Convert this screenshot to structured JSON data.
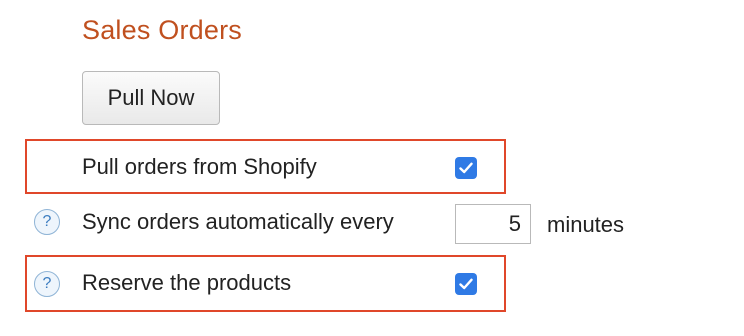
{
  "section": {
    "title": "Sales Orders"
  },
  "pull_button": {
    "label": "Pull Now"
  },
  "settings": {
    "pull_orders": {
      "label": "Pull orders from Shopify",
      "checked": true
    },
    "sync_interval": {
      "help_icon": "?",
      "label": "Sync orders automatically every",
      "value": "5",
      "unit": "minutes"
    },
    "reserve_products": {
      "help_icon": "?",
      "label": "Reserve the products",
      "checked": true
    }
  },
  "colors": {
    "title": "#c0501f",
    "highlight_border": "#e0472a",
    "checkbox_fill": "#2f7ae5",
    "help_icon": "#3b7cc0"
  }
}
